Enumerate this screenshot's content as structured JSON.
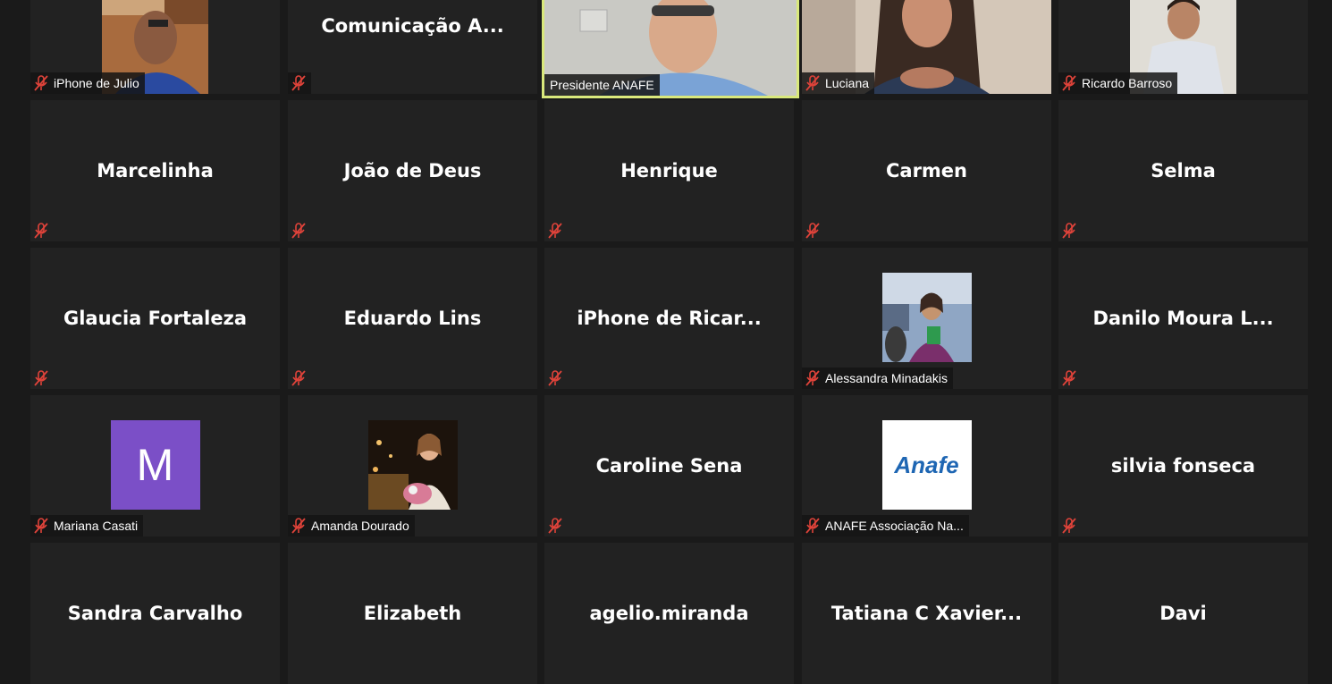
{
  "tiles": [
    {
      "name": "iPhone de Julio",
      "kind": "video"
    },
    {
      "name": "Comunicação A...",
      "kind": "name-top"
    },
    {
      "name": "Presidente ANAFE",
      "kind": "video-active"
    },
    {
      "name": "Luciana",
      "kind": "video"
    },
    {
      "name": "Ricardo Barroso",
      "kind": "video"
    },
    {
      "name": "Marcelinha",
      "kind": "name"
    },
    {
      "name": "João de Deus",
      "kind": "name"
    },
    {
      "name": "Henrique",
      "kind": "name"
    },
    {
      "name": "Carmen",
      "kind": "name"
    },
    {
      "name": "Selma",
      "kind": "name"
    },
    {
      "name": "Glaucia Fortaleza",
      "kind": "name"
    },
    {
      "name": "Eduardo Lins",
      "kind": "name"
    },
    {
      "name": "iPhone de Ricar...",
      "kind": "name"
    },
    {
      "name": "Alessandra Minadakis",
      "kind": "photo"
    },
    {
      "name": "Danilo Moura L...",
      "kind": "name"
    },
    {
      "name": "Mariana Casati",
      "kind": "letter",
      "letter": "M"
    },
    {
      "name": "Amanda Dourado",
      "kind": "photo"
    },
    {
      "name": "Caroline Sena",
      "kind": "name"
    },
    {
      "name": "ANAFE Associação Na...",
      "kind": "logo",
      "logo_text": "Anafe"
    },
    {
      "name": "silvia fonseca",
      "kind": "name"
    },
    {
      "name": "Sandra Carvalho",
      "kind": "name"
    },
    {
      "name": "Elizabeth",
      "kind": "name"
    },
    {
      "name": "agelio.miranda",
      "kind": "name"
    },
    {
      "name": "Tatiana C Xavier...",
      "kind": "name"
    },
    {
      "name": "Davi",
      "kind": "name"
    }
  ],
  "icons": {
    "muted": "mic-muted-icon"
  },
  "colors": {
    "active_border": "#d9e87c",
    "muted_icon": "#e0433a",
    "avatar_purple": "#7b4fc7",
    "tile_bg": "#222222"
  }
}
